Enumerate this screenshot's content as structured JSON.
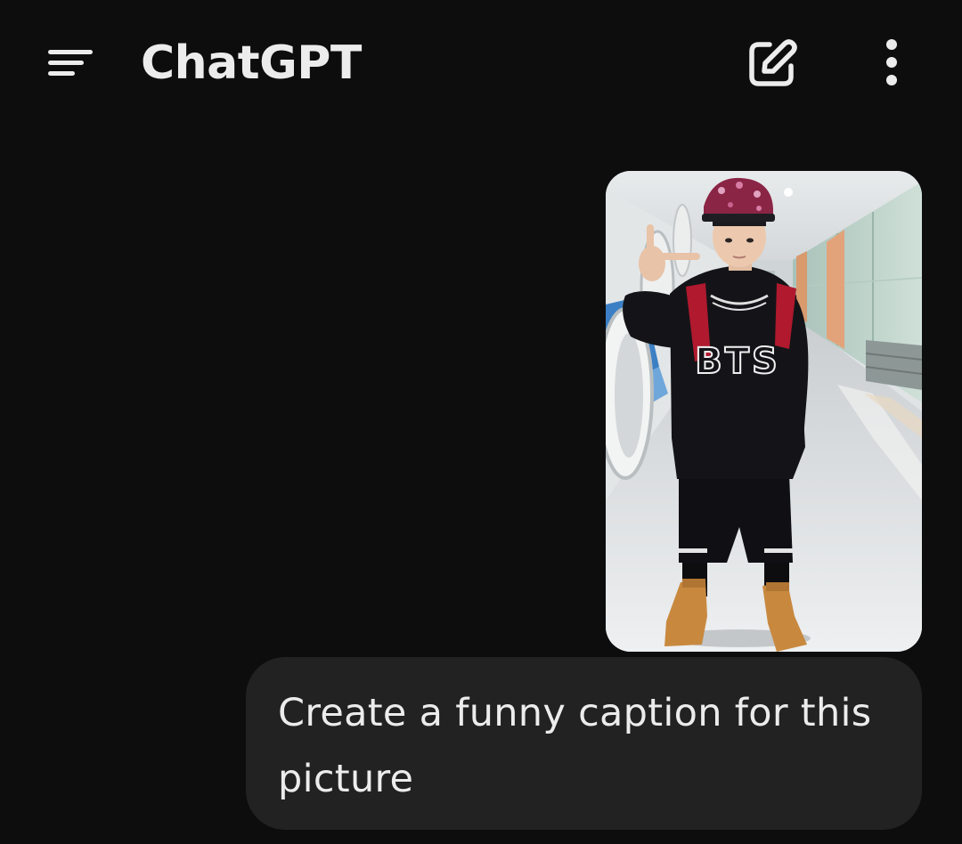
{
  "app_bar": {
    "title": "ChatGPT",
    "menu_icon": "hamburger-menu-icon",
    "new_chat_icon": "pencil-square-icon",
    "more_icon": "vertical-ellipsis-icon"
  },
  "conversation": {
    "user_message": {
      "attachment": {
        "kind": "photo",
        "shirt_print": "BTS"
      },
      "text": "Create a funny caption for this picture"
    }
  },
  "colors": {
    "background": "#0d0d0e",
    "bubble": "#222223",
    "text": "#ececec"
  }
}
